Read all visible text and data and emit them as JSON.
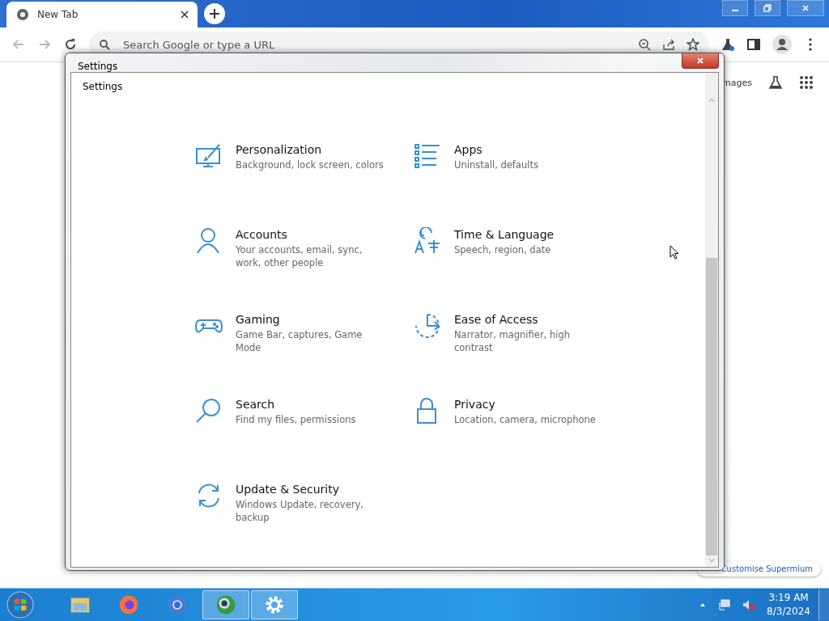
{
  "browser": {
    "tab": {
      "title": "New Tab"
    },
    "omnibox": {
      "placeholder": "Search Google or type a URL"
    },
    "page": {
      "link": "mages",
      "customise_button": "Customise Supermium"
    }
  },
  "settings_window": {
    "title": "Settings",
    "heading": "Settings",
    "items": [
      {
        "title": "Personalization",
        "description": "Background, lock screen, colors"
      },
      {
        "title": "Apps",
        "description": "Uninstall, defaults"
      },
      {
        "title": "Accounts",
        "description": "Your accounts, email, sync, work, other people"
      },
      {
        "title": "Time & Language",
        "description": "Speech, region, date"
      },
      {
        "title": "Gaming",
        "description": "Game Bar, captures, Game Mode"
      },
      {
        "title": "Ease of Access",
        "description": "Narrator, magnifier, high contrast"
      },
      {
        "title": "Search",
        "description": "Find my files, permissions"
      },
      {
        "title": "Privacy",
        "description": "Location, camera, microphone"
      },
      {
        "title": "Update & Security",
        "description": "Windows Update, recovery, backup"
      }
    ]
  },
  "taskbar": {
    "items": [
      {
        "kind": "folder",
        "active": false
      },
      {
        "kind": "firefox",
        "active": false
      },
      {
        "kind": "chrome",
        "active": false
      },
      {
        "kind": "globe",
        "active": true
      },
      {
        "kind": "gear",
        "active": true
      }
    ],
    "clock": {
      "time": "3:19 AM",
      "date": "8/3/2024"
    }
  }
}
